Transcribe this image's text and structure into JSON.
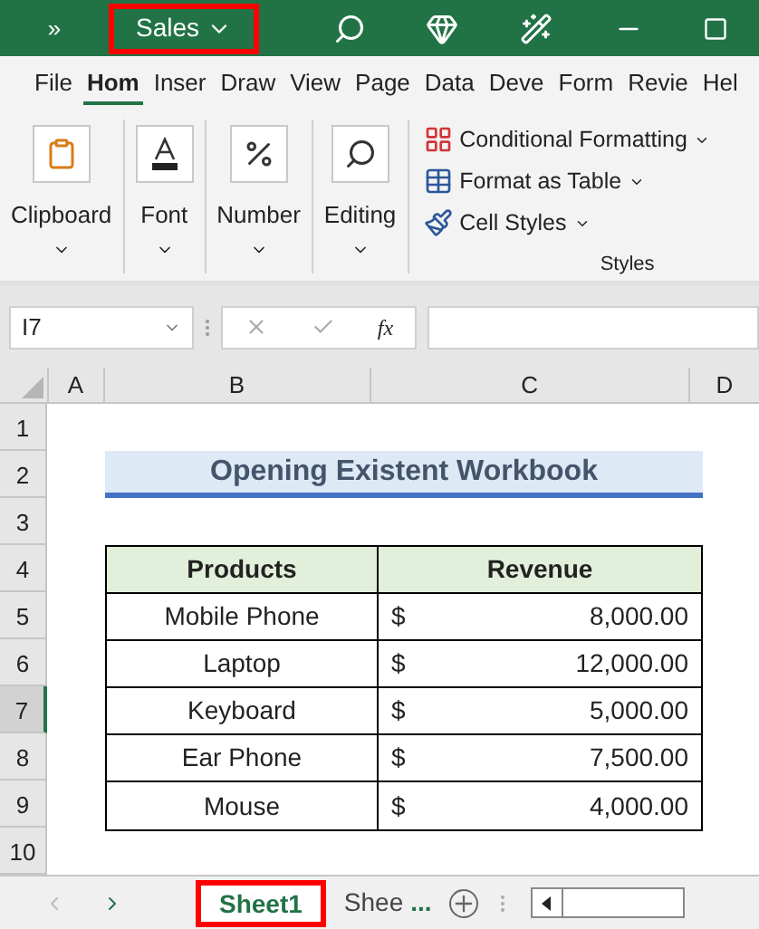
{
  "title_bar": {
    "overflow": "»",
    "file_name": "Sales",
    "highlighted": true
  },
  "ribbon_tabs": [
    {
      "label": "File",
      "selected": false
    },
    {
      "label": "Hom",
      "selected": true
    },
    {
      "label": "Inser",
      "selected": false
    },
    {
      "label": "Draw",
      "selected": false
    },
    {
      "label": "View",
      "selected": false
    },
    {
      "label": "Page",
      "selected": false
    },
    {
      "label": "Data",
      "selected": false
    },
    {
      "label": "Deve",
      "selected": false
    },
    {
      "label": "Form",
      "selected": false
    },
    {
      "label": "Revie",
      "selected": false
    },
    {
      "label": "Hel",
      "selected": false
    }
  ],
  "ribbon_groups": [
    {
      "kind": "clipboard",
      "label": "Clipboard"
    },
    {
      "kind": "font",
      "label": "Font"
    },
    {
      "kind": "number",
      "label": "Number"
    },
    {
      "kind": "editing",
      "label": "Editing"
    }
  ],
  "styles_group": {
    "items": [
      {
        "kind": "conditional",
        "label": "Conditional Formatting"
      },
      {
        "kind": "table",
        "label": "Format as Table"
      },
      {
        "kind": "cellstyles",
        "label": "Cell Styles"
      }
    ],
    "label": "Styles"
  },
  "formula_bar": {
    "name_box": "I7",
    "fx": "fx"
  },
  "columns": [
    {
      "label": "A",
      "selected": false
    },
    {
      "label": "B",
      "selected": false
    },
    {
      "label": "C",
      "selected": false
    },
    {
      "label": "D",
      "selected": false
    }
  ],
  "row_headers": [
    {
      "label": "1",
      "selected": false
    },
    {
      "label": "2",
      "selected": false
    },
    {
      "label": "3",
      "selected": false
    },
    {
      "label": "4",
      "selected": false
    },
    {
      "label": "5",
      "selected": false
    },
    {
      "label": "6",
      "selected": false
    },
    {
      "label": "7",
      "selected": true
    },
    {
      "label": "8",
      "selected": false
    },
    {
      "label": "9",
      "selected": false
    },
    {
      "label": "10",
      "selected": false
    }
  ],
  "sheet_title": "Opening Existent Workbook",
  "table": {
    "columns": [
      "Products",
      "Revenue"
    ],
    "rows": [
      {
        "product": "Mobile Phone",
        "currency": "$",
        "revenue": "8,000.00"
      },
      {
        "product": "Laptop",
        "currency": "$",
        "revenue": "12,000.00"
      },
      {
        "product": "Keyboard",
        "currency": "$",
        "revenue": "5,000.00"
      },
      {
        "product": "Ear Phone",
        "currency": "$",
        "revenue": "7,500.00"
      },
      {
        "product": "Mouse",
        "currency": "$",
        "revenue": "4,000.00"
      }
    ]
  },
  "sheet_tabs": [
    {
      "label": "Sheet1",
      "selected": true,
      "highlighted": true
    },
    {
      "label": "Shee",
      "selected": false,
      "highlighted": false
    }
  ],
  "more_sheets": "..."
}
